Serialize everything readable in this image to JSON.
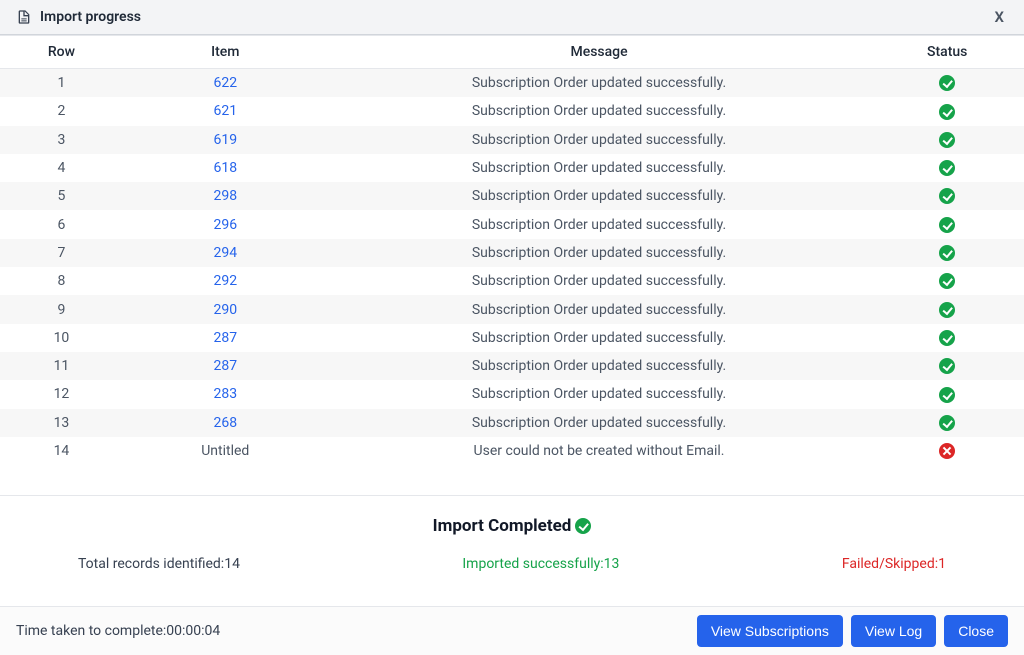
{
  "header": {
    "title": "Import progress",
    "close": "X"
  },
  "columns": {
    "row": "Row",
    "item": "Item",
    "message": "Message",
    "status": "Status"
  },
  "rows": [
    {
      "row": "1",
      "item": "622",
      "link": true,
      "message": "Subscription Order updated successfully.",
      "ok": true
    },
    {
      "row": "2",
      "item": "621",
      "link": true,
      "message": "Subscription Order updated successfully.",
      "ok": true
    },
    {
      "row": "3",
      "item": "619",
      "link": true,
      "message": "Subscription Order updated successfully.",
      "ok": true
    },
    {
      "row": "4",
      "item": "618",
      "link": true,
      "message": "Subscription Order updated successfully.",
      "ok": true
    },
    {
      "row": "5",
      "item": "298",
      "link": true,
      "message": "Subscription Order updated successfully.",
      "ok": true
    },
    {
      "row": "6",
      "item": "296",
      "link": true,
      "message": "Subscription Order updated successfully.",
      "ok": true
    },
    {
      "row": "7",
      "item": "294",
      "link": true,
      "message": "Subscription Order updated successfully.",
      "ok": true
    },
    {
      "row": "8",
      "item": "292",
      "link": true,
      "message": "Subscription Order updated successfully.",
      "ok": true
    },
    {
      "row": "9",
      "item": "290",
      "link": true,
      "message": "Subscription Order updated successfully.",
      "ok": true
    },
    {
      "row": "10",
      "item": "287",
      "link": true,
      "message": "Subscription Order updated successfully.",
      "ok": true
    },
    {
      "row": "11",
      "item": "287",
      "link": true,
      "message": "Subscription Order updated successfully.",
      "ok": true
    },
    {
      "row": "12",
      "item": "283",
      "link": true,
      "message": "Subscription Order updated successfully.",
      "ok": true
    },
    {
      "row": "13",
      "item": "268",
      "link": true,
      "message": "Subscription Order updated successfully.",
      "ok": true
    },
    {
      "row": "14",
      "item": "Untitled",
      "link": false,
      "message": "User could not be created without Email.",
      "ok": false
    }
  ],
  "summary": {
    "title": "Import Completed",
    "total_label": "Total records identified:",
    "total_value": "14",
    "ok_label": "Imported successfully:",
    "ok_value": "13",
    "fail_label": "Failed/Skipped:",
    "fail_value": "1"
  },
  "footer": {
    "time_label": "Time taken to complete:",
    "time_value": "00:00:04",
    "buttons": {
      "view_subs": "View Subscriptions",
      "view_log": "View Log",
      "close": "Close"
    }
  }
}
